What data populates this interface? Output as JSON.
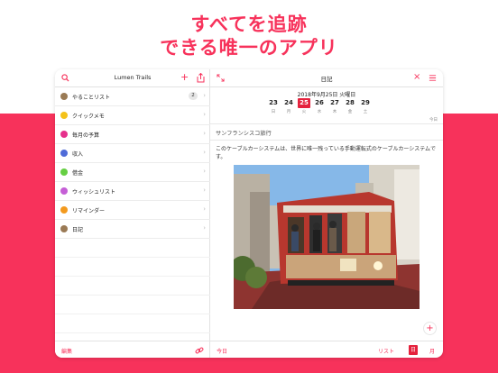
{
  "headline": {
    "line1": "すべてを追跡",
    "line2": "できる唯一のアプリ"
  },
  "colors": {
    "accent": "#f7325b",
    "selected_day": "#e5223d"
  },
  "sidebar": {
    "title": "Lumen Trails",
    "icons": [
      "search-icon",
      "plus-icon",
      "share-icon"
    ],
    "items": [
      {
        "label": "やることリスト",
        "color": "#9a7a55",
        "badge": "2"
      },
      {
        "label": "クイックメモ",
        "color": "#f4c21a",
        "badge": ""
      },
      {
        "label": "毎月の予算",
        "color": "#e6308c",
        "badge": ""
      },
      {
        "label": "収入",
        "color": "#4f6bd8",
        "badge": ""
      },
      {
        "label": "借金",
        "color": "#66cf43",
        "badge": ""
      },
      {
        "label": "ウィッシュリスト",
        "color": "#c55fd6",
        "badge": ""
      },
      {
        "label": "リマインダー",
        "color": "#f39a1e",
        "badge": ""
      },
      {
        "label": "日記",
        "color": "#9a7a55",
        "badge": ""
      }
    ],
    "footer_edit": "編集"
  },
  "main": {
    "title": "日記",
    "date_label": "2018年9月25日 火曜日",
    "days": [
      {
        "num": "23",
        "wd": "日",
        "selected": false
      },
      {
        "num": "24",
        "wd": "月",
        "selected": false
      },
      {
        "num": "25",
        "wd": "火",
        "selected": true
      },
      {
        "num": "26",
        "wd": "水",
        "selected": false
      },
      {
        "num": "27",
        "wd": "木",
        "selected": false
      },
      {
        "num": "28",
        "wd": "金",
        "selected": false
      },
      {
        "num": "29",
        "wd": "土",
        "selected": false
      }
    ],
    "today_mini": "今日",
    "entry_title": "サンフランシスコ旅行",
    "entry_text": "このケーブルカーシステムは、世界に唯一残っている手動運転式のケーブルカーシステムです。",
    "photo_alt": "cable-car-photo",
    "footer": {
      "today": "今日",
      "list": "リスト",
      "day": "日",
      "month": "月"
    }
  }
}
